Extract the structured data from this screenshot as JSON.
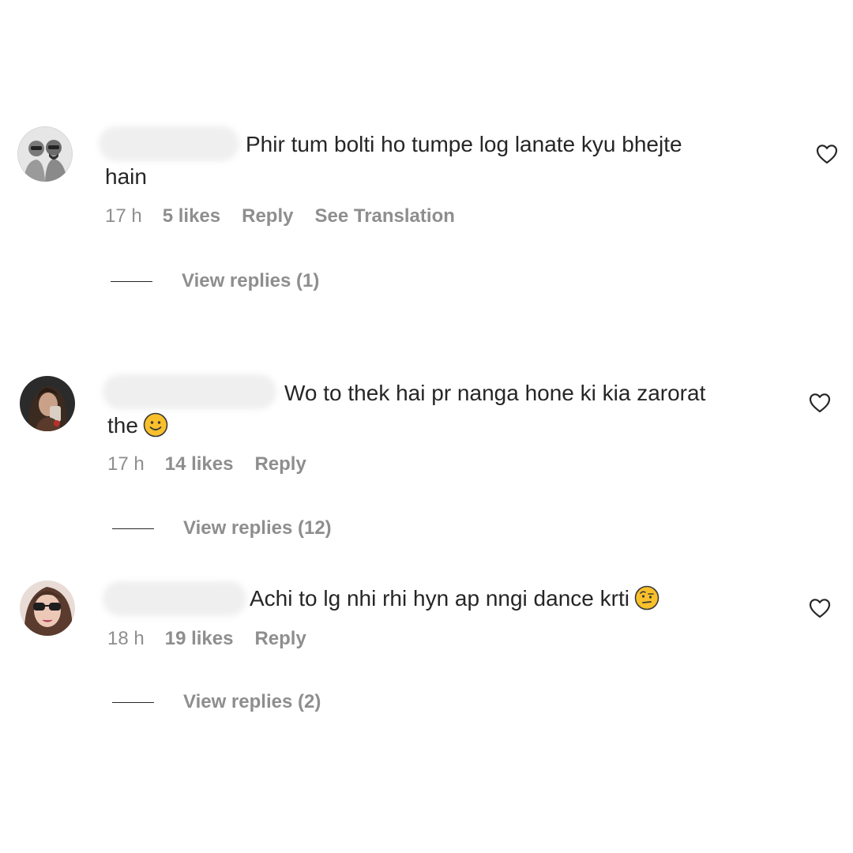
{
  "comments": [
    {
      "text_line1": "Phir tum bolti ho tumpe log lanate kyu bhejte",
      "text_line2": "hain",
      "time": "17 h",
      "likes": "5 likes",
      "reply": "Reply",
      "translation": "See Translation",
      "view_replies": "View replies (1)",
      "avatar_icon": "avatar-couple-sketch",
      "emoji": null
    },
    {
      "text_line1": "Wo to thek hai pr nanga hone ki kia zarorat",
      "text_line2": "the",
      "time": "17 h",
      "likes": "14 likes",
      "reply": "Reply",
      "view_replies": "View replies (12)",
      "avatar_icon": "avatar-woman-selfie",
      "emoji": "slightly-smiling-face-emoji"
    },
    {
      "text_line1": "Achi to lg nhi rhi hyn ap nngi dance krti",
      "time": "18 h",
      "likes": "19 likes",
      "reply": "Reply",
      "view_replies": "View replies (2)",
      "avatar_icon": "avatar-woman-sunglasses",
      "emoji": "face-with-raised-eyebrow-emoji"
    }
  ],
  "icons": {
    "like": "heart-outline-icon"
  },
  "colors": {
    "text": "#262626",
    "secondary": "#8e8e8e",
    "emoji": "#f9c02b"
  }
}
